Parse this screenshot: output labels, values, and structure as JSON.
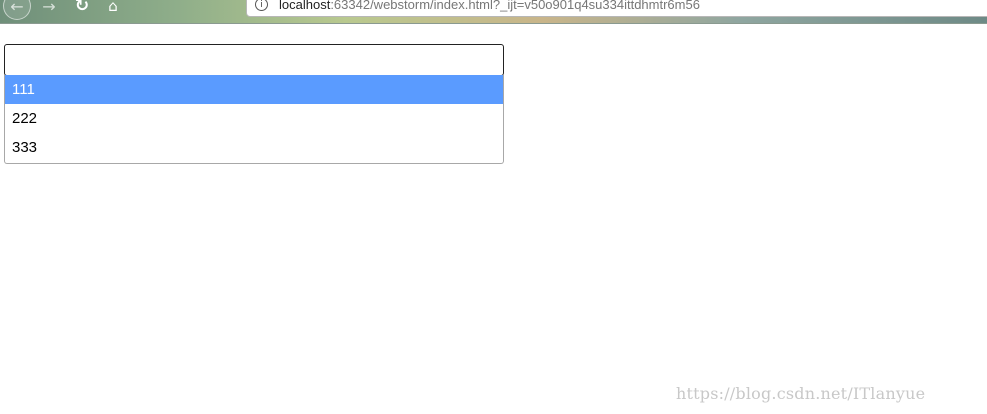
{
  "browser": {
    "nav": {
      "back_icon": "←",
      "forward_icon": "→",
      "reload_icon": "↻",
      "home_icon": "⌂"
    },
    "url": {
      "info_icon": "i",
      "host": "localhost",
      "rest": ":63342/webstorm/index.html?_ijt=v50o901q4su334ittdhmtr6m56"
    }
  },
  "select": {
    "value": "",
    "options": [
      {
        "label": "111",
        "selected": true
      },
      {
        "label": "222",
        "selected": false
      },
      {
        "label": "333",
        "selected": false
      }
    ],
    "highlight_color": "#5a9bff"
  },
  "watermark": "https://blog.csdn.net/ITlanyue"
}
